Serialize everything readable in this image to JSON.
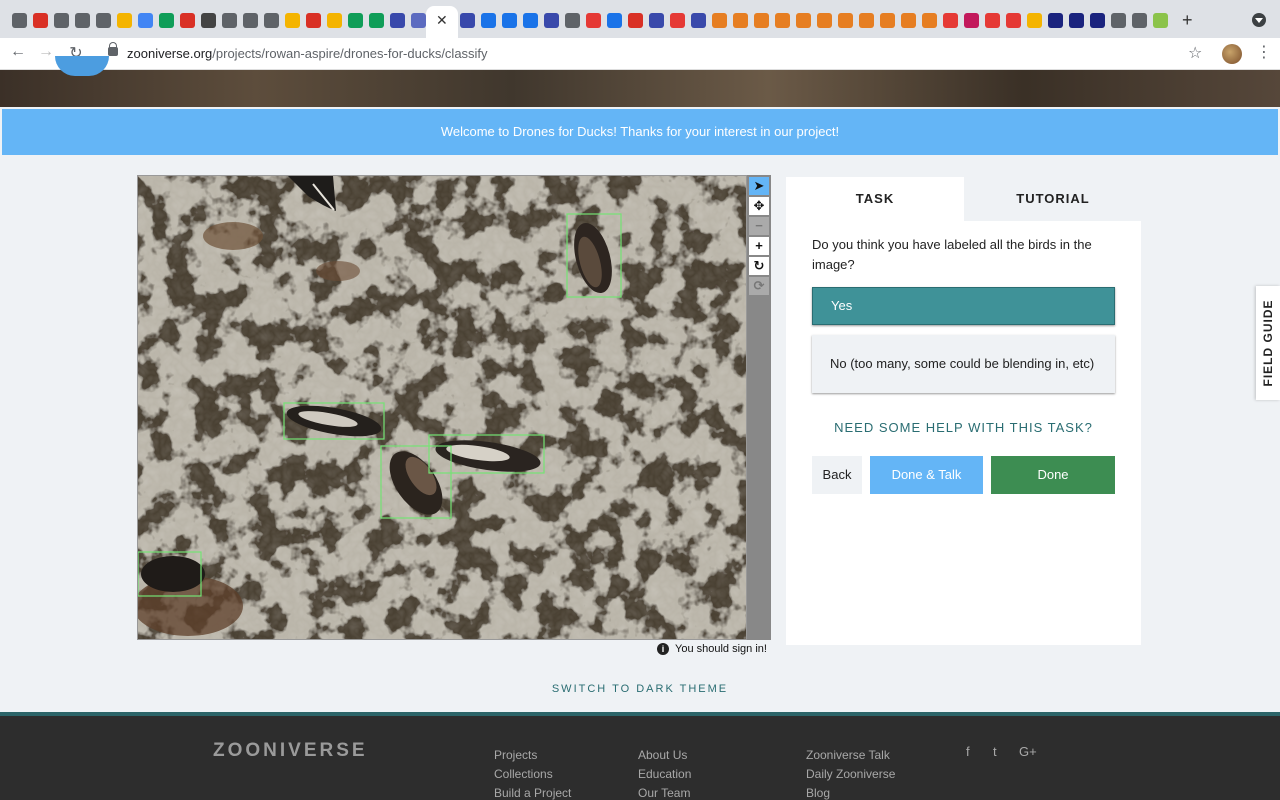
{
  "browser": {
    "url_domain": "zooniverse.org",
    "url_path": "/projects/rowan-aspire/drones-for-ducks/classify",
    "tab_favicon_colors": [
      "#5f6368",
      "#d93025",
      "#5f6368",
      "#5f6368",
      "#5f6368",
      "#f4b400",
      "#4285f4",
      "#0f9d58",
      "#d93025",
      "#444444",
      "#5f6368",
      "#5f6368",
      "#5f6368",
      "#f4b400",
      "#d93025",
      "#f4b400",
      "#0f9d58",
      "#0f9d58",
      "#3949ab",
      "#5c6bc0",
      "#3949ab",
      "#1a73e8",
      "#1a73e8",
      "#1a73e8",
      "#3949ab",
      "#5f6368",
      "#e53935",
      "#1a73e8",
      "#d93025",
      "#3949ab",
      "#e53935",
      "#3949ab",
      "#e67e22",
      "#e67e22",
      "#e67e22",
      "#e67e22",
      "#e67e22",
      "#e67e22",
      "#e67e22",
      "#e67e22",
      "#e67e22",
      "#e67e22",
      "#e67e22",
      "#e53935",
      "#c2185b",
      "#e53935",
      "#e53935",
      "#f4b400",
      "#1a237e",
      "#1a237e",
      "#1a237e",
      "#5f6368",
      "#5f6368",
      "#8bc34a"
    ]
  },
  "banner": {
    "text": "Welcome to Drones for Ducks! Thanks for your interest in our project!"
  },
  "viewer": {
    "tools": [
      "pointer-icon",
      "move-icon",
      "zoom-out-icon",
      "zoom-in-icon",
      "rotate-icon",
      "reset-icon"
    ],
    "signin_text": "You should sign in!"
  },
  "task_panel": {
    "tabs": [
      "TASK",
      "TUTORIAL"
    ],
    "question": "Do you think you have labeled all the birds in the image?",
    "answers": [
      {
        "label": "Yes",
        "selected": true
      },
      {
        "label": "No (too many, some could be blending in, etc)",
        "selected": false
      }
    ],
    "help_text": "NEED SOME HELP WITH THIS TASK?",
    "buttons": {
      "back": "Back",
      "done_talk": "Done & Talk",
      "done": "Done"
    }
  },
  "field_guide": "FIELD GUIDE",
  "dark_theme_text": "SWITCH TO DARK THEME",
  "footer": {
    "logo": "ZOONIVERSE",
    "col1": [
      "Projects",
      "Collections",
      "Build a Project"
    ],
    "col2": [
      "About Us",
      "Education",
      "Our Team"
    ],
    "col3": [
      "Zooniverse Talk",
      "Daily Zooniverse",
      "Blog"
    ],
    "social": [
      "f",
      "t",
      "G+"
    ]
  }
}
